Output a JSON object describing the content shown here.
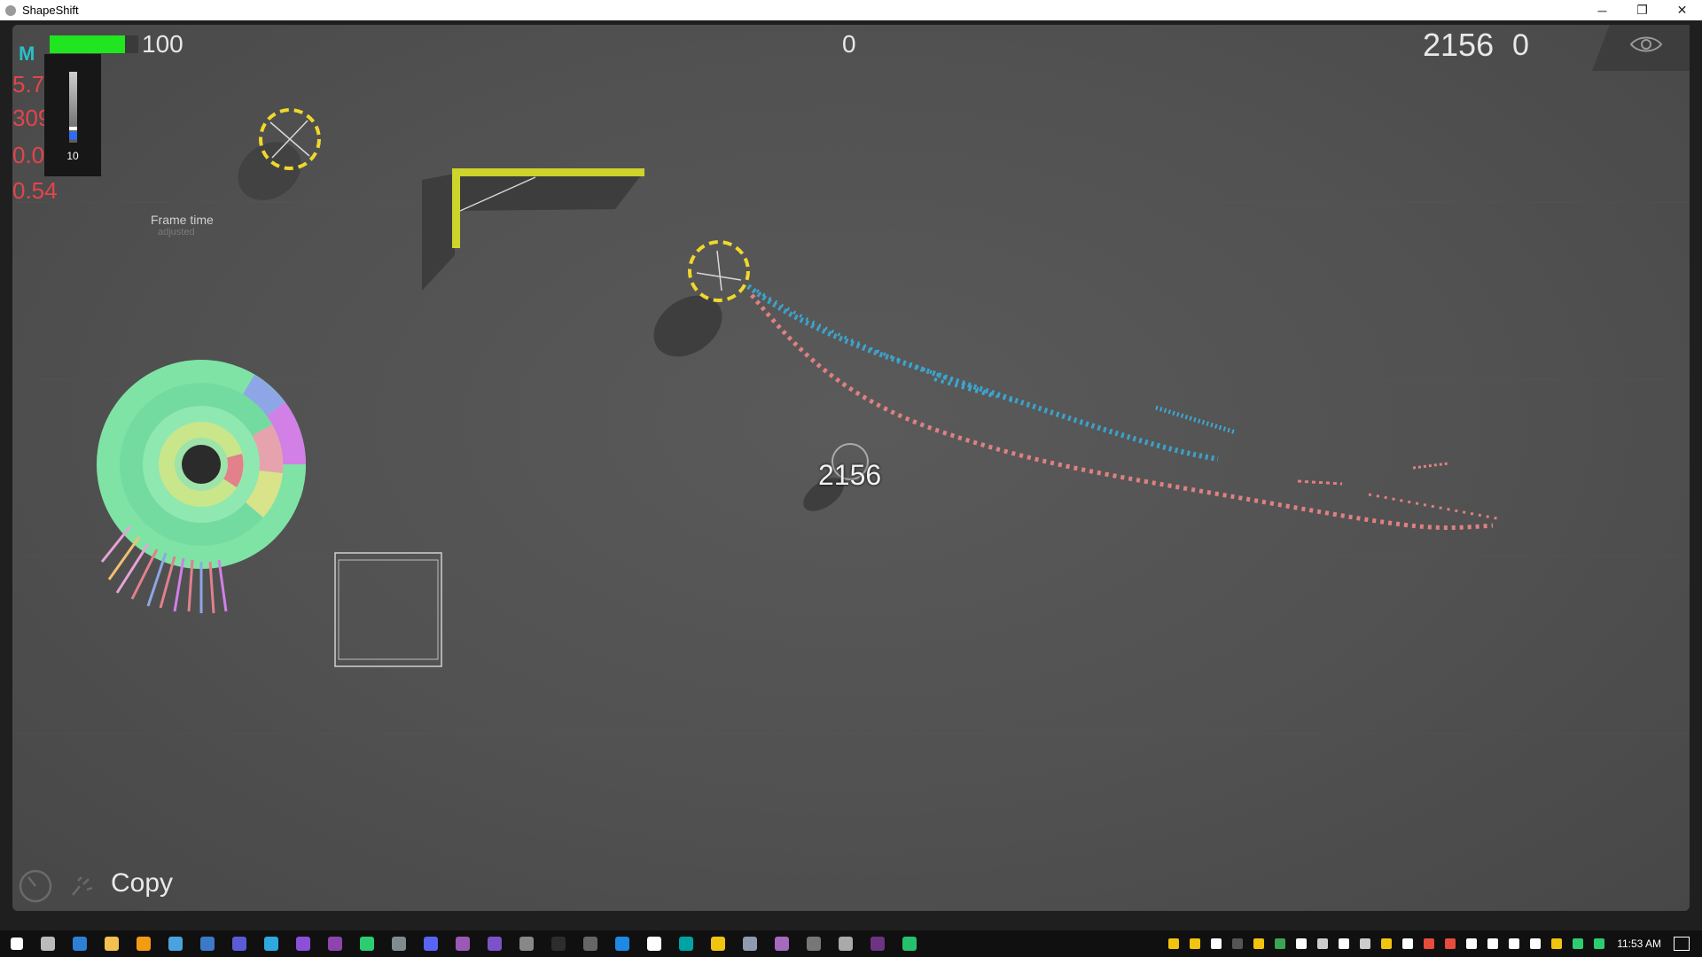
{
  "window": {
    "title": "ShapeShift",
    "buttons": {
      "minimize": "─",
      "restore": "❐",
      "close": "✕"
    }
  },
  "hud": {
    "health": {
      "value": "100",
      "fraction": 0.85,
      "color": "#1fe61f"
    },
    "center_score": "0",
    "score": "2156",
    "secondary_score": "0",
    "logo_letter": "M",
    "stats": [
      "5.7",
      "309",
      "0.0",
      "0.54"
    ],
    "slider": {
      "value": "10",
      "level_fraction": 0.1
    },
    "frame_time_label": "Frame time",
    "frame_time_sub": "adjusted",
    "popup_score": "2156",
    "copy_label": "Copy",
    "stats_color": "#e2454a"
  },
  "icons": {
    "eye": "eye-icon",
    "bottom": [
      "gauge-icon",
      "sparkle-icon"
    ]
  },
  "taskbar": {
    "clock": "11:53 AM",
    "app_colors": [
      "#ffffff",
      "#bbbbbb",
      "#2e7fd6",
      "#f2c14e",
      "#f39c12",
      "#4aa3df",
      "#3c79c8",
      "#5b5bd6",
      "#2ea8e0",
      "#8c4fd8",
      "#8e44ad",
      "#2ecc71",
      "#7f8c8d",
      "#5865f2",
      "#9b59b6",
      "#7b52c8",
      "#888888",
      "#2d2d2d",
      "#666666",
      "#1e88e5",
      "#ffffff",
      "#00a3a3",
      "#f1c40f",
      "#8e9aaf",
      "#a569bd",
      "#777777",
      "#aaaaaa",
      "#6c3483",
      "#25c26e"
    ],
    "tray_colors": [
      "#f1c40f",
      "#f1c40f",
      "#ffffff",
      "#555555",
      "#f1c40f",
      "#3aa655",
      "#ffffff",
      "#cccccc",
      "#ffffff",
      "#cccccc",
      "#f1c40f",
      "#ffffff",
      "#e74c3c",
      "#e74c3c",
      "#ffffff",
      "#ffffff",
      "#ffffff",
      "#ffffff",
      "#f1c40f",
      "#2ecc71",
      "#2ecc71"
    ]
  },
  "colors": {
    "reticle": "#f0d82c",
    "wall": "#cdd42a",
    "trail_blue": "#3aaad6",
    "trail_pink": "#e08080"
  }
}
